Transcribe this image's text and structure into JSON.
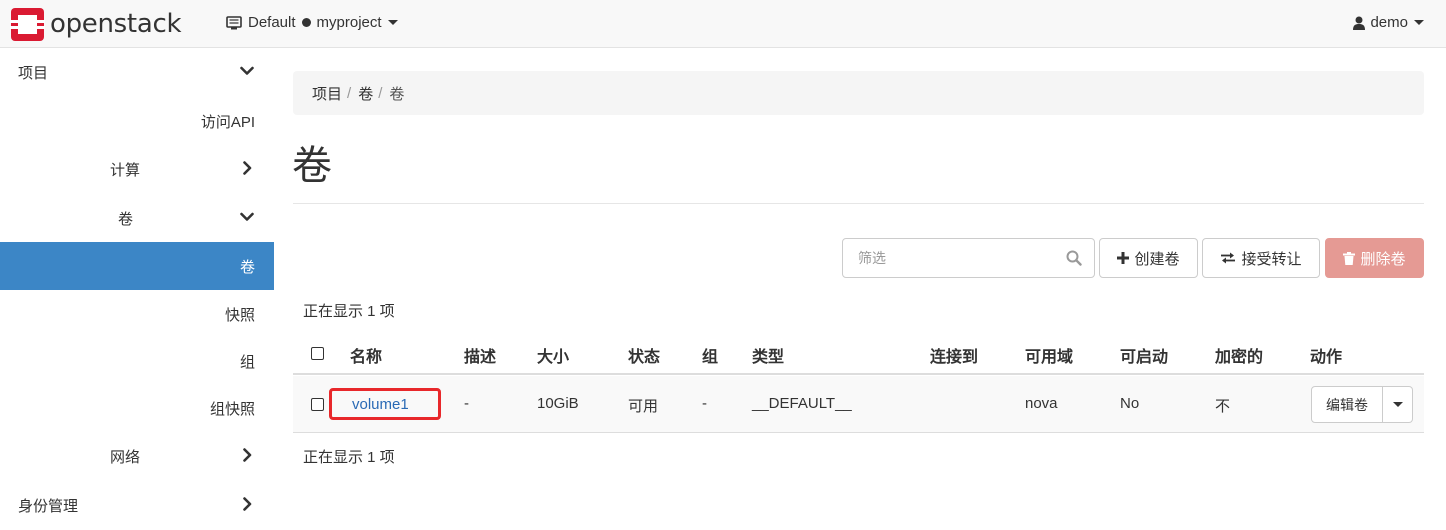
{
  "navbar": {
    "brand": "openstack",
    "project_domain": "Default",
    "project_name": "myproject",
    "user": "demo",
    "icons": {
      "project": "desktop-icon",
      "user": "user-icon",
      "brand": "openstack-logo"
    },
    "brand_color": "#da1a32"
  },
  "sidebar": {
    "items": [
      {
        "label": "项目",
        "chevron": "down"
      },
      {
        "label": "访问API"
      },
      {
        "label": "计算",
        "chevron": "right"
      },
      {
        "label": "卷",
        "chevron": "down"
      },
      {
        "label": "卷",
        "active": true
      },
      {
        "label": "快照"
      },
      {
        "label": "组"
      },
      {
        "label": "组快照"
      },
      {
        "label": "网络",
        "chevron": "right"
      },
      {
        "label": "身份管理",
        "chevron": "right"
      }
    ],
    "active_color": "#3c86c6"
  },
  "breadcrumb": {
    "items": [
      "项目",
      "卷",
      "卷"
    ]
  },
  "page": {
    "title": "卷"
  },
  "toolbar": {
    "filter_placeholder": "筛选",
    "create_label": "创建卷",
    "accept_label": "接受转让",
    "delete_label": "删除卷",
    "delete_color": "#e59a94"
  },
  "table": {
    "count_text": "正在显示 1 项",
    "columns": [
      "名称",
      "描述",
      "大小",
      "状态",
      "组",
      "类型",
      "连接到",
      "可用域",
      "可启动",
      "加密的",
      "动作"
    ],
    "rows": [
      {
        "name": "volume1",
        "description": "-",
        "size": "10GiB",
        "status": "可用",
        "group": "-",
        "type": "__DEFAULT__",
        "attached_to": "",
        "availability_zone": "nova",
        "bootable": "No",
        "encrypted": "不",
        "action_label": "编辑卷"
      }
    ]
  }
}
